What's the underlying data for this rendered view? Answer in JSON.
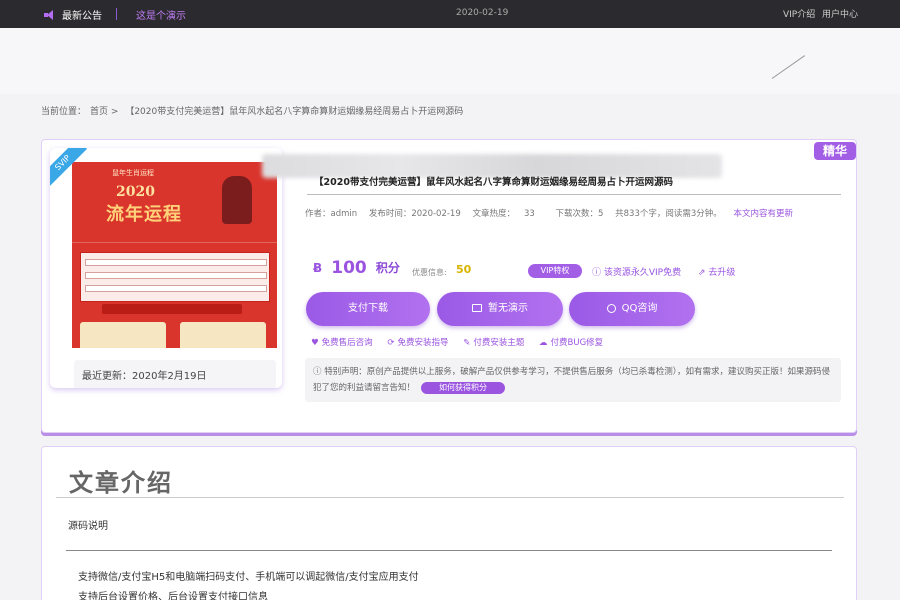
{
  "topbar": {
    "announcement": "最新公告",
    "demo_link": "这是个演示",
    "date": "2020-02-19",
    "vip_intro": "VIP介绍",
    "user_center": "用户中心",
    "icon": "speaker-icon"
  },
  "breadcrumb": {
    "prefix": "当前位置：",
    "home": "首页",
    "separator": ">",
    "current": "【2020带支付完美运营】鼠年风水起名八字算命算财运姻缘易经周易占卜开运网源码"
  },
  "product": {
    "svip_badge": "SVIP",
    "essence_badge": "精华",
    "thumbnail_texts": {
      "year": "2020",
      "headline": "流年运程",
      "top_title": "鼠年生肖运程"
    },
    "updated": "最近更新：2020年2月19日",
    "title": "【2020带支付完美运营】鼠年风水起名八字算命算财运姻缘易经周易占卜开运网源码",
    "meta": {
      "author": "作者：admin",
      "published": "发布时间：2020-02-19",
      "heat_label": "文章热度：",
      "heat": "33",
      "downloads": "下载次数：5",
      "words": "共833个字，阅读需3分钟。",
      "update_note": "本文内容有更新"
    },
    "price": {
      "coin_icon": "Ƀ",
      "amount": "100",
      "unit": "积分",
      "discount_label": "优惠信息:",
      "discount_value": "50"
    },
    "vip_badge": "VIP特权",
    "vip_free": "该资源永久VIP免费",
    "upgrade": "去升级",
    "buttons": {
      "pay": "支付下载",
      "demo": "暂无演示",
      "qq": "QQ咨询"
    },
    "services": [
      {
        "icon": "♥",
        "label": "免费售后咨询"
      },
      {
        "icon": "⟳",
        "label": "免费安装指导"
      },
      {
        "icon": "✎",
        "label": "付费安装主题"
      },
      {
        "icon": "☁",
        "label": "付费BUG修复"
      }
    ],
    "notice": {
      "text1": "特别声明：原创产品提供以上服务，破解产品仅供参考学习，不提供售后服务（均已杀毒检测），如有需求，建议购买正版！如果源码侵犯了您的利益请留言告知！",
      "button": "如何获得积分"
    }
  },
  "article": {
    "title": "文章介绍",
    "section_label": "源码说明",
    "lines": [
      "支持微信/支付宝H5和电脑端扫码支付、手机端可以调起微信/支付宝应用支付",
      "支持后台设置价格、后台设置支付接口信息"
    ]
  },
  "colors": {
    "accent": "#9a54e0",
    "topbar_bg": "#2b2b2f",
    "svip": "#3aa7e6",
    "discount": "#d8b400"
  }
}
